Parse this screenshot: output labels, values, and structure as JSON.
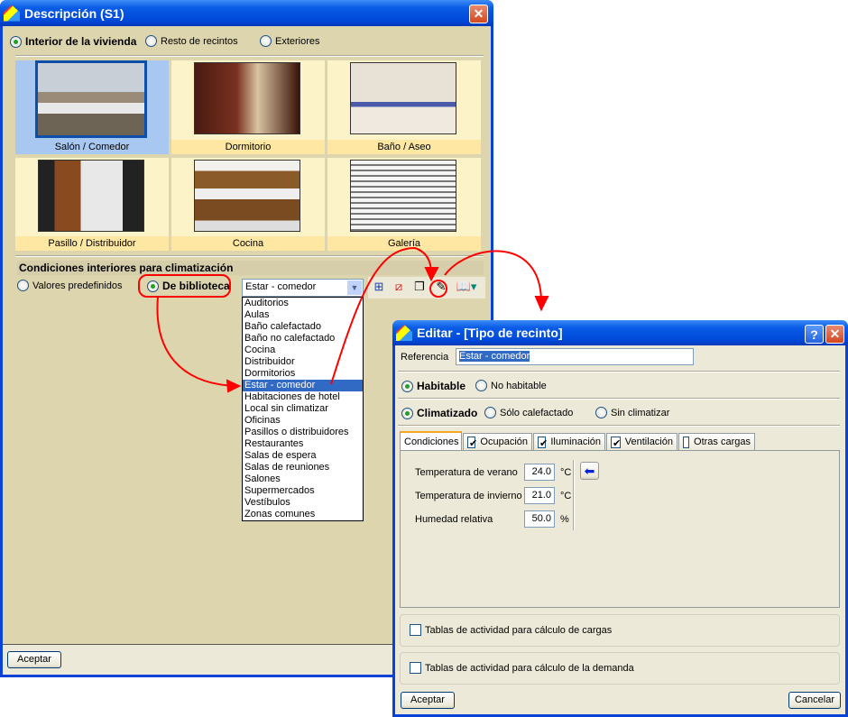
{
  "main_window": {
    "title": "Descripción (S1)",
    "scope_options": [
      {
        "label": "Interior de la vivienda",
        "selected": true
      },
      {
        "label": "Resto de recintos",
        "selected": false
      },
      {
        "label": "Exteriores",
        "selected": false
      }
    ],
    "rooms": [
      {
        "label": "Salón / Comedor",
        "selected": true
      },
      {
        "label": "Dormitorio"
      },
      {
        "label": "Baño / Aseo"
      },
      {
        "label": "Pasillo / Distribuidor"
      },
      {
        "label": "Cocina"
      },
      {
        "label": "Galería"
      }
    ],
    "conditions_title": "Condiciones interiores para climatización",
    "source_options": [
      {
        "label": "Valores predefinidos",
        "selected": false
      },
      {
        "label": "De biblioteca",
        "selected": true
      }
    ],
    "library_combo_value": "Estar - comedor",
    "library_list": [
      "Auditorios",
      "Aulas",
      "Baño calefactado",
      "Baño no calefactado",
      "Cocina",
      "Distribuidor",
      "Dormitorios",
      "Estar - comedor",
      "Habitaciones de hotel",
      "Local sin climatizar",
      "Oficinas",
      "Pasillos o distribuidores",
      "Restaurantes",
      "Salas de espera",
      "Salas de reuniones",
      "Salones",
      "Supermercados",
      "Vestíbulos",
      "Zonas comunes"
    ],
    "library_selected_index": 7,
    "ok_label": "Aceptar"
  },
  "edit_dialog": {
    "title": "Editar - [Tipo de recinto]",
    "help_label": "?",
    "reference_label": "Referencia",
    "reference_value": "Estar - comedor",
    "habitable_options": [
      {
        "label": "Habitable",
        "selected": true
      },
      {
        "label": "No habitable",
        "selected": false
      }
    ],
    "climate_options": [
      {
        "label": "Climatizado",
        "selected": true
      },
      {
        "label": "Sólo calefactado",
        "selected": false
      },
      {
        "label": "Sin climatizar",
        "selected": false
      }
    ],
    "tabs": [
      {
        "label": "Condiciones",
        "active": true
      },
      {
        "label": "Ocupación",
        "checked": true
      },
      {
        "label": "Iluminación",
        "checked": true
      },
      {
        "label": "Ventilación",
        "checked": true
      },
      {
        "label": "Otras cargas",
        "checked": false
      }
    ],
    "fields": [
      {
        "label": "Temperatura de verano",
        "value": "24.0",
        "unit": "°C"
      },
      {
        "label": "Temperatura de invierno",
        "value": "21.0",
        "unit": "°C"
      },
      {
        "label": "Humedad relativa",
        "value": "50.0",
        "unit": "%"
      }
    ],
    "load_tables_label": "Tablas de actividad para cálculo de cargas",
    "demand_tables_label": "Tablas de actividad para cálculo de la demanda",
    "ok_label": "Aceptar",
    "cancel_label": "Cancelar"
  },
  "colors": {
    "annotation": "#ff0000",
    "titlebar": "#0a5ce6",
    "selection": "#316ac5"
  }
}
